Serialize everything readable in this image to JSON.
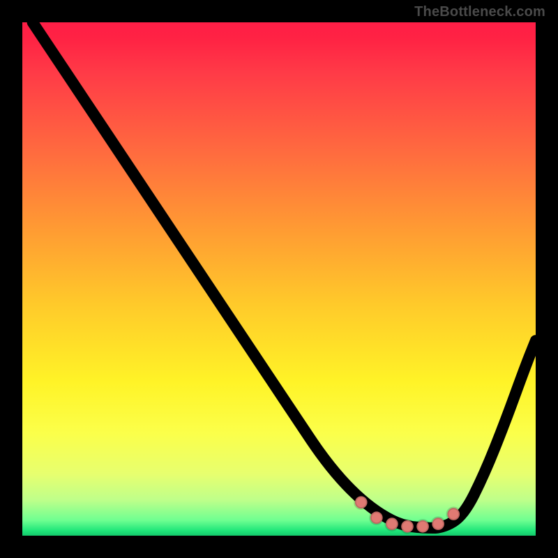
{
  "watermark": "TheBottleneck.com",
  "chart_data": {
    "type": "line",
    "title": "",
    "xlabel": "",
    "ylabel": "",
    "xlim": [
      0,
      100
    ],
    "ylim": [
      0,
      100
    ],
    "grid": false,
    "legend": false,
    "series": [
      {
        "name": "bottleneck-curve",
        "x": [
          2,
          6,
          12,
          18,
          24,
          30,
          36,
          42,
          48,
          54,
          58,
          62,
          66,
          70,
          74,
          78,
          82,
          86,
          90,
          94,
          98,
          100
        ],
        "y": [
          100,
          94,
          85,
          76,
          67,
          58,
          49,
          40,
          31,
          22,
          16,
          11,
          7,
          4,
          2,
          1.5,
          1.5,
          4,
          12,
          22,
          33,
          38
        ]
      }
    ],
    "highlight_range_x": [
      66,
      84
    ],
    "highlight_dots": [
      {
        "x": 66,
        "y": 6.5
      },
      {
        "x": 69,
        "y": 3.5
      },
      {
        "x": 72,
        "y": 2.3
      },
      {
        "x": 75,
        "y": 1.8
      },
      {
        "x": 78,
        "y": 1.8
      },
      {
        "x": 81,
        "y": 2.3
      },
      {
        "x": 84,
        "y": 4.2
      }
    ],
    "background_gradient": {
      "orientation": "vertical",
      "stops": [
        {
          "pos": 0.0,
          "color": "#ff1e46"
        },
        {
          "pos": 0.25,
          "color": "#ff6a3f"
        },
        {
          "pos": 0.55,
          "color": "#ffca2a"
        },
        {
          "pos": 0.8,
          "color": "#fbff4a"
        },
        {
          "pos": 0.97,
          "color": "#6fff91"
        },
        {
          "pos": 1.0,
          "color": "#14c96c"
        }
      ]
    }
  }
}
